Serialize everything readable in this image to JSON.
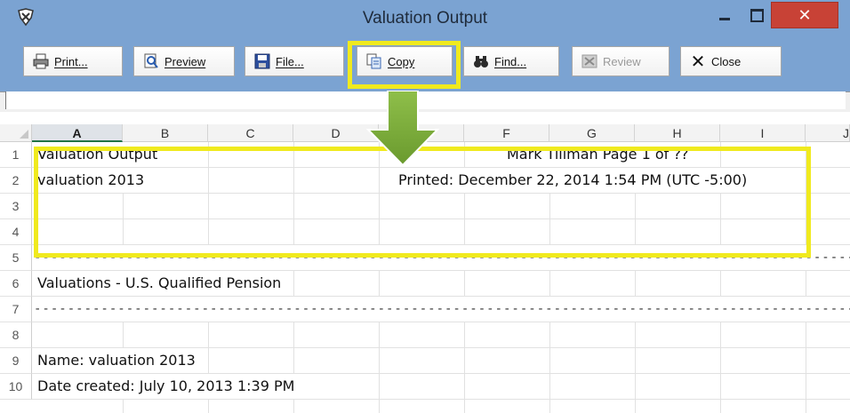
{
  "window": {
    "title": "Valuation Output",
    "close_glyph": "✕"
  },
  "toolbar": {
    "buttons": [
      {
        "label": "Print...",
        "icon": "printer-icon"
      },
      {
        "label": "Preview",
        "icon": "preview-icon"
      },
      {
        "label": "File...",
        "icon": "floppy-disk-icon"
      },
      {
        "label": "Copy",
        "icon": "copy-icon"
      },
      {
        "label": "Find...",
        "icon": "binoculars-icon"
      },
      {
        "label": "Review",
        "icon": "review-icon",
        "disabled": true
      },
      {
        "label": "Close",
        "icon": "close-x-icon"
      }
    ]
  },
  "sheet": {
    "columns": [
      "A",
      "B",
      "C",
      "D",
      "E",
      "F",
      "G",
      "H",
      "I",
      "J"
    ],
    "selected_column": "A",
    "rows": [
      "1",
      "2",
      "3",
      "4",
      "5",
      "6",
      "7",
      "8",
      "9",
      "10"
    ],
    "cells": {
      "r1_left": "Valuation Output",
      "r1_right": "Mark Tillman Page 1 of ??",
      "r2_left": "valuation 2013",
      "r2_right": "Printed: December 22, 2014  1:54 PM  (UTC -5:00)",
      "r5_dashes": "-----------------------------------------------------------------------------------------------------------------------------------------",
      "r6": "Valuations - U.S. Qualified Pension",
      "r7_dashes": "-----------------------------------------------------------------------------------------------------------------------------------------",
      "r9": "Name:  valuation 2013",
      "r10": "Date created:  July 10, 2013  1:39 PM"
    }
  },
  "colors": {
    "window_chrome": "#7ba3d2",
    "highlight": "#f0ea1e",
    "arrow": "#7dab3a",
    "close_button": "#c84236"
  }
}
